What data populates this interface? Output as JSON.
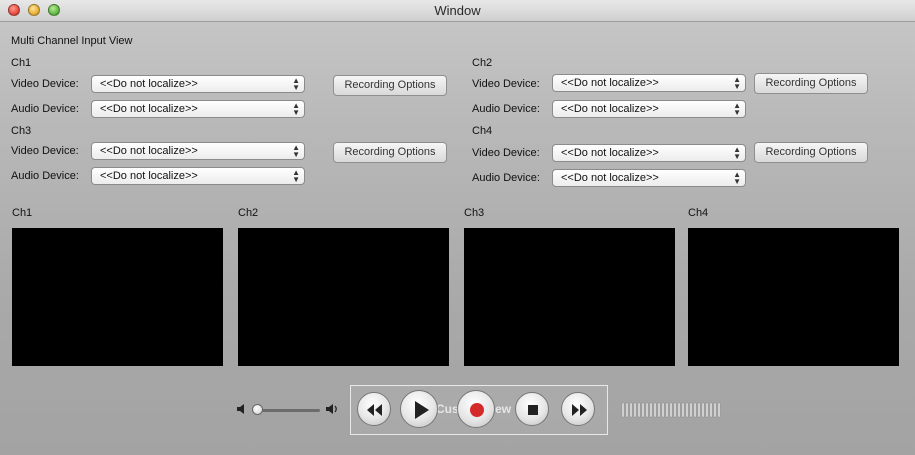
{
  "window": {
    "title": "Window"
  },
  "section_title": "Multi Channel Input View",
  "channels": [
    {
      "name": "Ch1",
      "video_label": "Video Device:",
      "video_value": "<<Do not localize>>",
      "audio_label": "Audio Device:",
      "audio_value": "<<Do not localize>>",
      "options_label": "Recording Options"
    },
    {
      "name": "Ch2",
      "video_label": "Video Device:",
      "video_value": "<<Do not localize>>",
      "audio_label": "Audio Device:",
      "audio_value": "<<Do not localize>>",
      "options_label": "Recording Options"
    },
    {
      "name": "Ch3",
      "video_label": "Video Device:",
      "video_value": "<<Do not localize>>",
      "audio_label": "Audio Device:",
      "audio_value": "<<Do not localize>>",
      "options_label": "Recording Options"
    },
    {
      "name": "Ch4",
      "video_label": "Video Device:",
      "video_value": "<<Do not localize>>",
      "audio_label": "Audio Device:",
      "audio_value": "<<Do not localize>>",
      "options_label": "Recording Options"
    }
  ],
  "previews": [
    {
      "label": "Ch1"
    },
    {
      "label": "Ch2"
    },
    {
      "label": "Ch3"
    },
    {
      "label": "Ch4"
    }
  ],
  "transport": {
    "ghost_label": "Custom View",
    "buttons": [
      "rewind-icon",
      "play-icon",
      "record-icon",
      "stop-icon",
      "fast-forward-icon"
    ]
  },
  "volume": {
    "level": 0.0
  },
  "colors": {
    "record": "#d42a2a",
    "screen": "#000000"
  }
}
